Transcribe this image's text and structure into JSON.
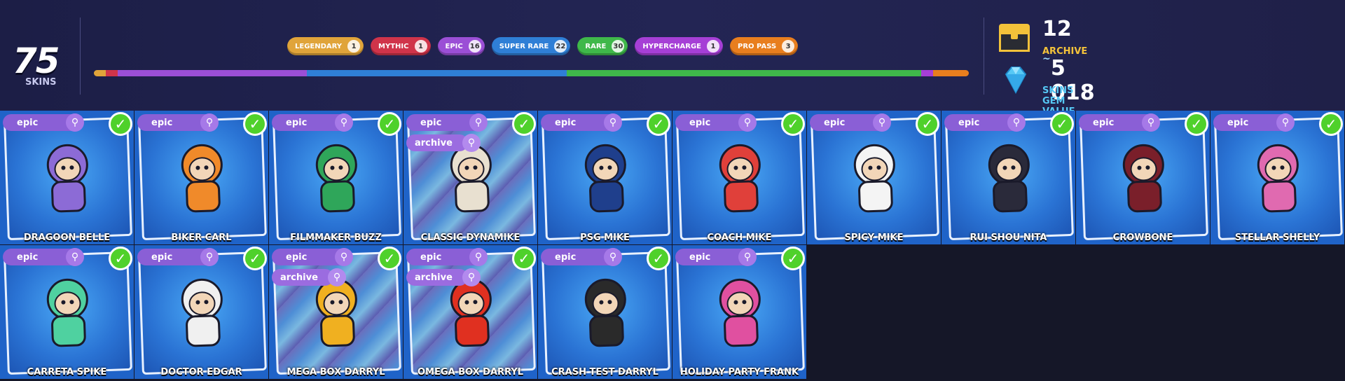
{
  "summary": {
    "count": "75",
    "count_label": "SKINS"
  },
  "rarities": [
    {
      "label": "LEGENDARY",
      "count": "1",
      "color": "#e0a43a"
    },
    {
      "label": "MYTHIC",
      "count": "1",
      "color": "#d0344a"
    },
    {
      "label": "EPIC",
      "count": "16",
      "color": "#9b4fd6"
    },
    {
      "label": "SUPER RARE",
      "count": "22",
      "color": "#2f7fd6"
    },
    {
      "label": "RARE",
      "count": "30",
      "color": "#3fb84a"
    },
    {
      "label": "HYPERCHARGE",
      "count": "1",
      "color": "#a63fd6"
    },
    {
      "label": "PRO PASS",
      "count": "3",
      "color": "#e87e1e"
    }
  ],
  "stats": {
    "archive_value": "12",
    "archive_label": "ARCHIVE",
    "gem_prefix": "~",
    "gem_value": "5 018",
    "gem_label": "SKINS GEM VALUE",
    "archive_color": "#f3c23a",
    "gem_color": "#56c8f5"
  },
  "skins": [
    {
      "name": "DRAGOON BELLE",
      "rarity": "epic",
      "archive": false
    },
    {
      "name": "BIKER CARL",
      "rarity": "epic",
      "archive": false
    },
    {
      "name": "FILMMAKER BUZZ",
      "rarity": "epic",
      "archive": false
    },
    {
      "name": "CLASSIC DYNAMIKE",
      "rarity": "epic",
      "archive": true,
      "archive_label": "archive"
    },
    {
      "name": "PSG MIKE",
      "rarity": "epic",
      "archive": false
    },
    {
      "name": "COACH MIKE",
      "rarity": "epic",
      "archive": false
    },
    {
      "name": "SPICY MIKE",
      "rarity": "epic",
      "archive": false
    },
    {
      "name": "RUI SHOU NITA",
      "rarity": "epic",
      "archive": false
    },
    {
      "name": "CROWBONE",
      "rarity": "epic",
      "archive": false
    },
    {
      "name": "STELLAR SHELLY",
      "rarity": "epic",
      "archive": false
    },
    {
      "name": "CARRETA SPIKE",
      "rarity": "epic",
      "archive": false
    },
    {
      "name": "DOCTOR EDGAR",
      "rarity": "epic",
      "archive": false
    },
    {
      "name": "MEGA BOX DARRYL",
      "rarity": "epic",
      "archive": true,
      "archive_label": "archive"
    },
    {
      "name": "OMEGA BOX DARRYL",
      "rarity": "epic",
      "archive": true,
      "archive_label": "archive"
    },
    {
      "name": "CRASH TEST DARRYL",
      "rarity": "epic",
      "archive": false
    },
    {
      "name": "HOLIDAY PARTY FRANK",
      "rarity": "epic",
      "archive": false
    }
  ]
}
